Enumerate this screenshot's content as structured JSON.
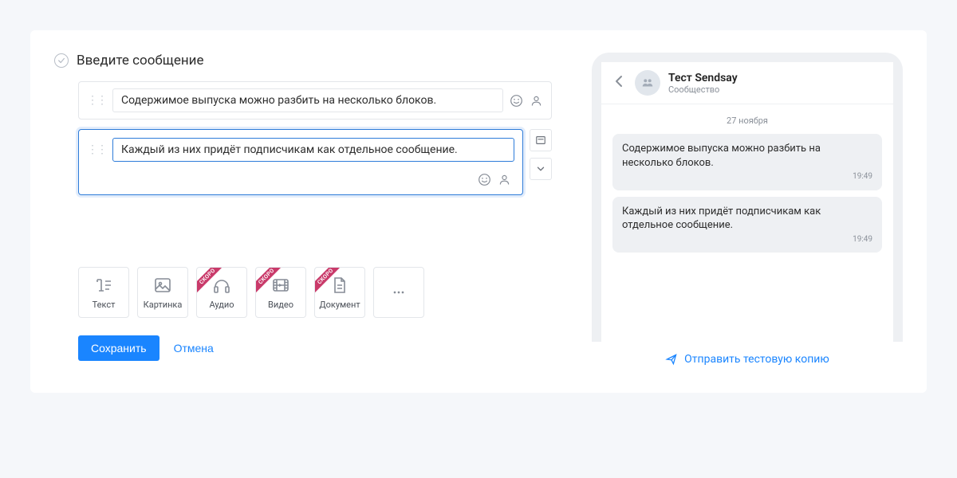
{
  "section": {
    "title": "Введите сообщение"
  },
  "blocks": [
    {
      "text": "Содержимое выпуска можно разбить на несколько блоков."
    },
    {
      "text": "Каждый из них придёт подписчикам как отдельное сообщение."
    }
  ],
  "toolbar": {
    "text": "Текст",
    "image": "Картинка",
    "audio": "Аудио",
    "video": "Видео",
    "document": "Документ",
    "soon": "СКОРО"
  },
  "actions": {
    "save": "Сохранить",
    "cancel": "Отмена"
  },
  "preview": {
    "chat_name": "Тест Sendsay",
    "chat_sub": "Сообщество",
    "date": "27 ноября",
    "messages": [
      {
        "text": "Содержимое выпуска можно разбить на несколько блоков.",
        "time": "19:49"
      },
      {
        "text": "Каждый из них придёт подписчикам как отдельное сообщение.",
        "time": "19:49"
      }
    ],
    "send_test": "Отправить тестовую копию"
  }
}
